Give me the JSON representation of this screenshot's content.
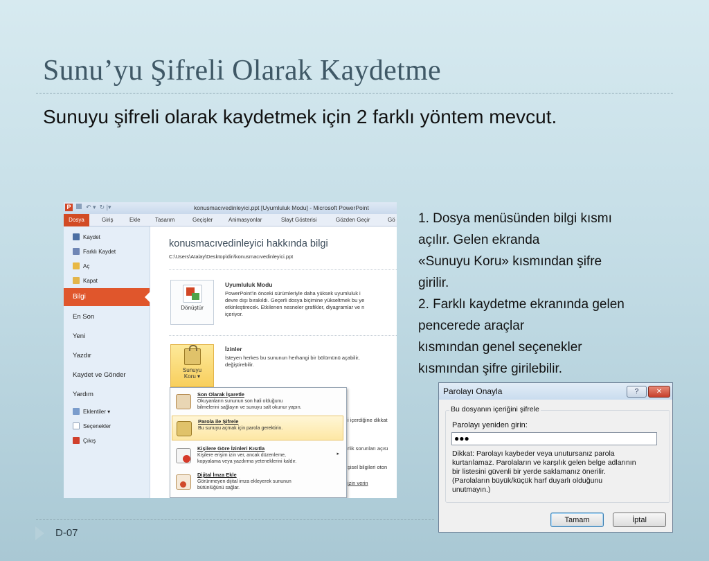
{
  "slide": {
    "title": "Sunu’yu Şifreli Olarak Kaydetme",
    "subtitle": "Sunuyu şifreli olarak kaydetmek için 2 farklı yöntem mevcut.",
    "body_lines": [
      "1. Dosya menüsünden bilgi kısmı",
      "açılır. Gelen ekranda",
      "«Sunuyu Koru» kısmından şifre",
      "girilir.",
      "2. Farklı kaydetme ekranında gelen",
      "pencerede araçlar",
      "kısmından genel seçenekler",
      "kısmından şifre girilebilir."
    ],
    "footer": "D-07"
  },
  "ppt": {
    "quick_access": "P  ▣  ↶ ▾  ↻  |▾",
    "window_title": "konusmacıvedinleyici.ppt [Uyumluluk Modu]  -  Microsoft PowerPoint",
    "tabs": [
      "Dosya",
      "Giriş",
      "Ekle",
      "Tasarım",
      "Geçişler",
      "Animasyonlar",
      "Slayt Gösterisi",
      "Gözden Geçir",
      "Gö"
    ],
    "nav_small": [
      "Kaydet",
      "Farklı Kaydet",
      "Aç",
      "Kapat"
    ],
    "nav_active": "Bilgi",
    "nav_items": [
      "En Son",
      "Yeni",
      "Yazdır",
      "Kaydet ve Gönder",
      "Yardım"
    ],
    "nav_bottom": [
      "Eklentiler ▾",
      "Seçenekler",
      "Çıkış"
    ],
    "main_title": "konusmacıvedinleyici hakkında bilgi",
    "path": "C:\\Users\\Atalay\\Desktop\\din\\konusmacıvedinleyici.ppt",
    "compat": {
      "button": "Dönüştür",
      "title": "Uyumluluk Modu",
      "lines": [
        "PowerPoint'in önceki sürümleriyle daha yüksek uyumluluk i",
        "devre dışı bırakıldı. Geçerli dosya biçimine yükseltmek bu ye",
        "etkinleştirecek. Etkilenen nesneler grafikler, diyagramlar ve n",
        "içeriyor."
      ]
    },
    "perm": {
      "button_l1": "Sunuyu",
      "button_l2": "Koru ▾",
      "title": "İzinler",
      "lines": [
        "İsteyen herkes bu sununun herhangi bir bölümünü açabilir,",
        "değiştirebilir."
      ]
    },
    "dropdown": [
      {
        "title": "Son Olarak İşaretle",
        "desc1": "Okuyanların sununun son hali olduğunu",
        "desc2": "bilmelerini sağlayın ve sunuyu salt okunur yapın."
      },
      {
        "title": "Parola ile Şifrele",
        "desc1": "Bu sunuyu açmak için parola gerektirin.",
        "desc2": ""
      },
      {
        "title": "Kişilere Göre İzinleri Kısıtla",
        "desc1": "Kişilere erişim izin ver, ancak düzenleme,",
        "desc2": "kopyalama veya yazdırma yeteneklerini kaldır."
      },
      {
        "title": "Dijital İmza Ekle",
        "desc1": "Görünmeyen dijital imza ekleyerek sununun",
        "desc2": "bütünlüğünü sağlar."
      }
    ],
    "right_snippets": [
      "i içerdiğine dikkat",
      "rlik sorunları açısı",
      "şisel bilgileri oton",
      "izin verin"
    ]
  },
  "dialog": {
    "title": "Parolayı Onayla",
    "help": "?",
    "close": "✕",
    "group_label": "Bu dosyanın içeriğini şifrele",
    "field_label": "Parolayı yeniden girin:",
    "field_value": "●●●",
    "warning_lines": [
      "Dikkat: Parolayı kaybeder veya unutursanız parola",
      "kurtarılamaz. Parolaların ve karşılık gelen belge adlarının",
      "bir listesini güvenli bir yerde saklamanız önerilir.",
      "(Parolaların büyük/küçük harf duyarlı olduğunu",
      "unutmayın.)"
    ],
    "ok": "Tamam",
    "cancel": "İptal"
  }
}
